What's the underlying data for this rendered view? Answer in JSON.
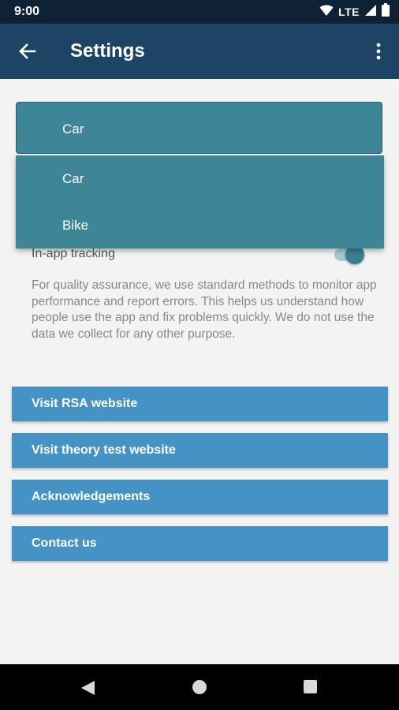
{
  "status_bar": {
    "time": "9:00",
    "network": "LTE"
  },
  "app_bar": {
    "title": "Settings"
  },
  "vehicle_select": {
    "selected": "Car",
    "options": [
      "Car",
      "Bike"
    ]
  },
  "tracking": {
    "label": "In-app tracking",
    "enabled": true,
    "description": "For quality assurance, we use standard methods to monitor app performance and report errors. This helps us understand how people use the app and fix problems quickly. We do not use the data we collect for any other purpose."
  },
  "links": [
    {
      "label": "Visit RSA website"
    },
    {
      "label": "Visit theory test website"
    },
    {
      "label": "Acknowledgements"
    },
    {
      "label": "Contact us"
    }
  ],
  "colors": {
    "app_bar": "#1d4465",
    "status_bar": "#0e2236",
    "selector": "#3d8597",
    "link_button": "#4493c4",
    "background": "#f3f3f3"
  }
}
